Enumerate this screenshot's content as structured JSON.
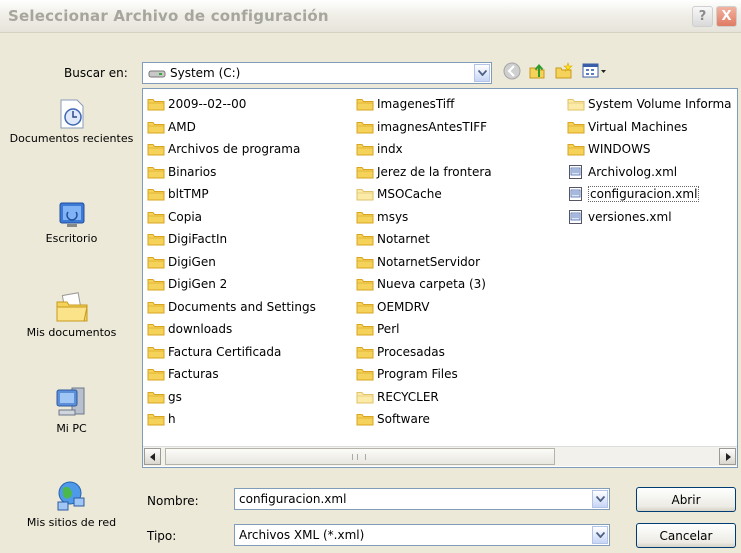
{
  "window": {
    "title": "Seleccionar Archivo de configuración",
    "help": "?",
    "close": "X"
  },
  "lookin": {
    "label": "Buscar en:",
    "value": "System (C:)"
  },
  "places": [
    {
      "label": "Documentos recientes",
      "icon": "recent-documents-icon"
    },
    {
      "label": "Escritorio",
      "icon": "desktop-icon"
    },
    {
      "label": "Mis documentos",
      "icon": "my-documents-icon"
    },
    {
      "label": "Mi PC",
      "icon": "my-computer-icon"
    },
    {
      "label": "Mis sitios de red",
      "icon": "network-places-icon"
    }
  ],
  "files": {
    "column1": [
      "2009--02--00",
      "AMD",
      "Archivos de programa",
      "Binarios",
      "bltTMP",
      "Copia",
      "DigiFactIn",
      "DigiGen",
      "DigiGen 2",
      "Documents and Settings",
      "downloads",
      "Factura Certificada",
      "Facturas",
      "gs",
      "h"
    ],
    "column2": [
      "ImagenesTiff",
      "imagnesAntesTIFF",
      "indx",
      "Jerez de la frontera",
      "MSOCache",
      "msys",
      "Notarnet",
      "NotarnetServidor",
      "Nueva carpeta (3)",
      "OEMDRV",
      "Perl",
      "Procesadas",
      "Program Files",
      "RECYCLER",
      "Software"
    ],
    "column3": [
      "System Volume Informa",
      "Virtual Machines",
      "WINDOWS",
      "Archivolog.xml",
      "configuracion.xml",
      "versiones.xml"
    ]
  },
  "filename": {
    "label": "Nombre:",
    "value": "configuracion.xml"
  },
  "filetype": {
    "label": "Tipo:",
    "value": "Archivos XML (*.xml)"
  },
  "buttons": {
    "open": "Abrir",
    "cancel": "Cancelar"
  },
  "colors": {
    "folder": "#f5d35a",
    "folder_dark": "#d9a520",
    "selection_border": "#666666",
    "field_border": "#7f9db9",
    "button_border": "#003c74"
  }
}
